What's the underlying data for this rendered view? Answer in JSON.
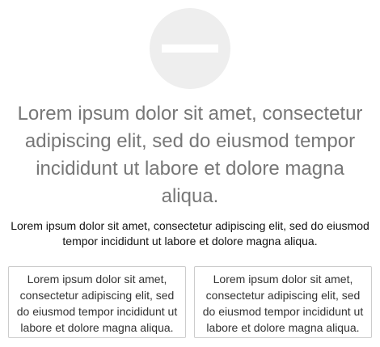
{
  "icon": {
    "name": "minus-circle-icon",
    "circle_color": "#eeeeee",
    "bar_color": "#ffffff"
  },
  "headline": "Lorem ipsum dolor sit amet, consectetur adipiscing elit, sed do eiusmod tempor incididunt ut labore et dolore magna aliqua.",
  "subtext": "Lorem ipsum dolor sit amet, consectetur adipiscing elit, sed do eiusmod tempor incididunt ut labore et dolore magna aliqua.",
  "buttons": [
    {
      "label": "Lorem ipsum dolor sit amet, consectetur adipiscing elit, sed do eiusmod tempor incididunt ut labore et dolore magna aliqua."
    },
    {
      "label": "Lorem ipsum dolor sit amet, consectetur adipiscing elit, sed do eiusmod tempor incididunt ut labore et dolore magna aliqua."
    }
  ],
  "colors": {
    "headline": "#777777",
    "subtext": "#111111",
    "button_border": "#cccccc"
  }
}
